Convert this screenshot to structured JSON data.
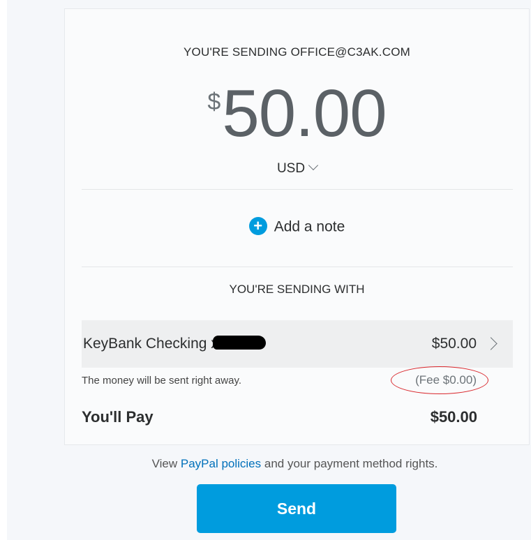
{
  "header": {
    "recipient_text": "YOU'RE SENDING OFFICE@C3AK.COM"
  },
  "amount": {
    "symbol": "$",
    "value": "50.00",
    "currency": "USD"
  },
  "note": {
    "label": "Add a note"
  },
  "funding": {
    "heading": "YOU'RE SENDING WITH",
    "source_name": "KeyBank Checking x",
    "source_amount": "$50.00",
    "delivery_text": "The money will be sent right away.",
    "fee_text": "(Fee $0.00)"
  },
  "total": {
    "label": "You'll Pay",
    "amount": "$50.00"
  },
  "policies": {
    "prefix": "View ",
    "link": "PayPal policies",
    "suffix": " and your payment method rights."
  },
  "actions": {
    "send_label": "Send"
  },
  "colors": {
    "accent": "#009cde",
    "link": "#0070ba",
    "annotation": "#d9262b"
  }
}
